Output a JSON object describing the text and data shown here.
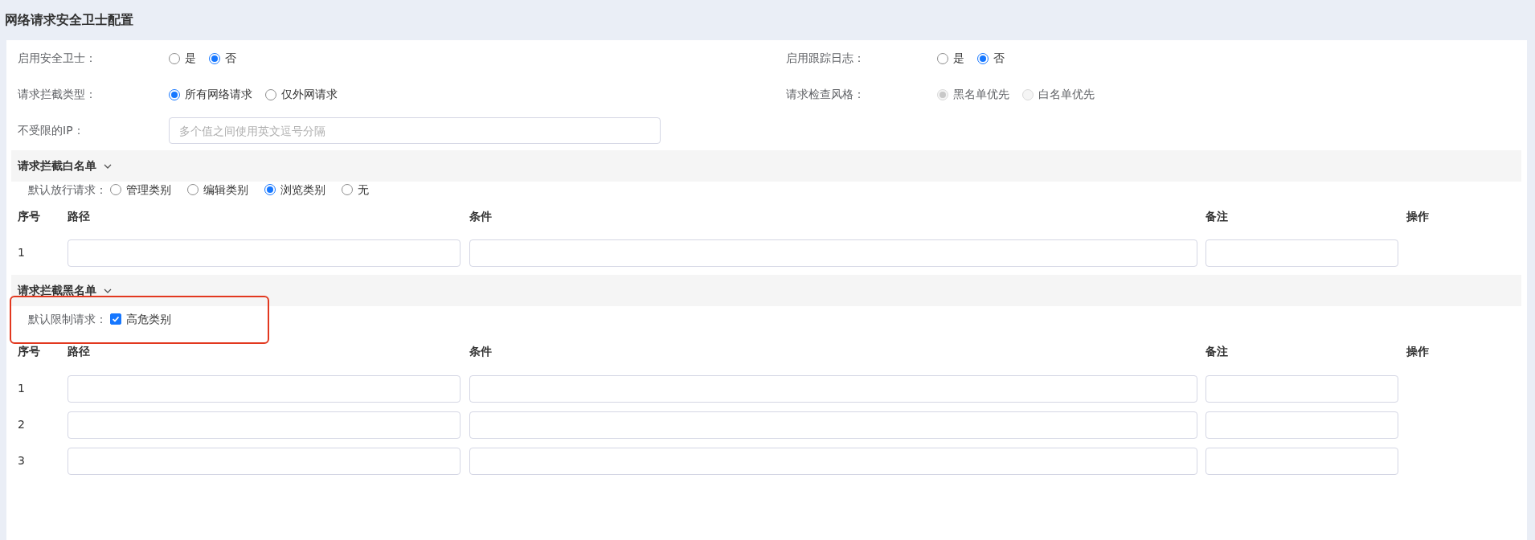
{
  "title": "网络请求安全卫士配置",
  "fields": [
    {
      "kind": "radio",
      "label": "启用安全卫士：",
      "options": [
        {
          "label": "是",
          "selected": false,
          "disabled": false
        },
        {
          "label": "否",
          "selected": true,
          "disabled": false
        }
      ]
    },
    {
      "kind": "radio",
      "label": "启用跟踪日志：",
      "options": [
        {
          "label": "是",
          "selected": false,
          "disabled": false
        },
        {
          "label": "否",
          "selected": true,
          "disabled": false
        }
      ]
    },
    {
      "kind": "radio",
      "label": "请求拦截类型：",
      "options": [
        {
          "label": "所有网络请求",
          "selected": true,
          "disabled": false
        },
        {
          "label": "仅外网请求",
          "selected": false,
          "disabled": false
        }
      ]
    },
    {
      "kind": "radio",
      "label": "请求检查风格：",
      "options": [
        {
          "label": "黑名单优先",
          "selected": true,
          "disabled": true
        },
        {
          "label": "白名单优先",
          "selected": false,
          "disabled": true
        }
      ]
    },
    {
      "kind": "input",
      "label": "不受限的IP：",
      "placeholder": "多个值之间使用英文逗号分隔"
    }
  ],
  "sections": [
    {
      "title": "请求拦截白名单",
      "expanded": true,
      "default": {
        "label": "默认放行请求：",
        "kind": "radio",
        "highlighted": false,
        "options": [
          {
            "label": "管理类别",
            "selected": false
          },
          {
            "label": "编辑类别",
            "selected": false
          },
          {
            "label": "浏览类别",
            "selected": true
          },
          {
            "label": "无",
            "selected": false
          }
        ]
      },
      "columns": [
        "序号",
        "路径",
        "条件",
        "备注",
        "操作"
      ],
      "rows": [
        {
          "index": "1"
        }
      ]
    },
    {
      "title": "请求拦截黑名单",
      "expanded": true,
      "default": {
        "label": "默认限制请求：",
        "kind": "checkbox",
        "highlighted": true,
        "options": [
          {
            "label": "高危类别",
            "checked": true
          }
        ]
      },
      "columns": [
        "序号",
        "路径",
        "条件",
        "备注",
        "操作"
      ],
      "rows": [
        {
          "index": "1"
        },
        {
          "index": "2"
        },
        {
          "index": "3"
        }
      ]
    }
  ]
}
